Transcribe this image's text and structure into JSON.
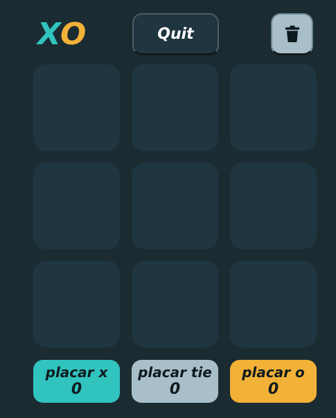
{
  "header": {
    "logo_x": "X",
    "logo_o": "O",
    "quit_label": "Quit",
    "trash_icon": "trash-icon"
  },
  "board": {
    "cells": [
      "",
      "",
      "",
      "",
      "",
      "",
      "",
      "",
      ""
    ]
  },
  "scores": [
    {
      "label": "placar x",
      "value": "0"
    },
    {
      "label": "placar tie",
      "value": "0"
    },
    {
      "label": "placar o",
      "value": "0"
    }
  ],
  "colors": {
    "background": "#1b2b32",
    "cell": "#1f3540",
    "x_accent": "#31c3bd",
    "o_accent": "#f2b137",
    "tie_accent": "#a8bfc9"
  }
}
